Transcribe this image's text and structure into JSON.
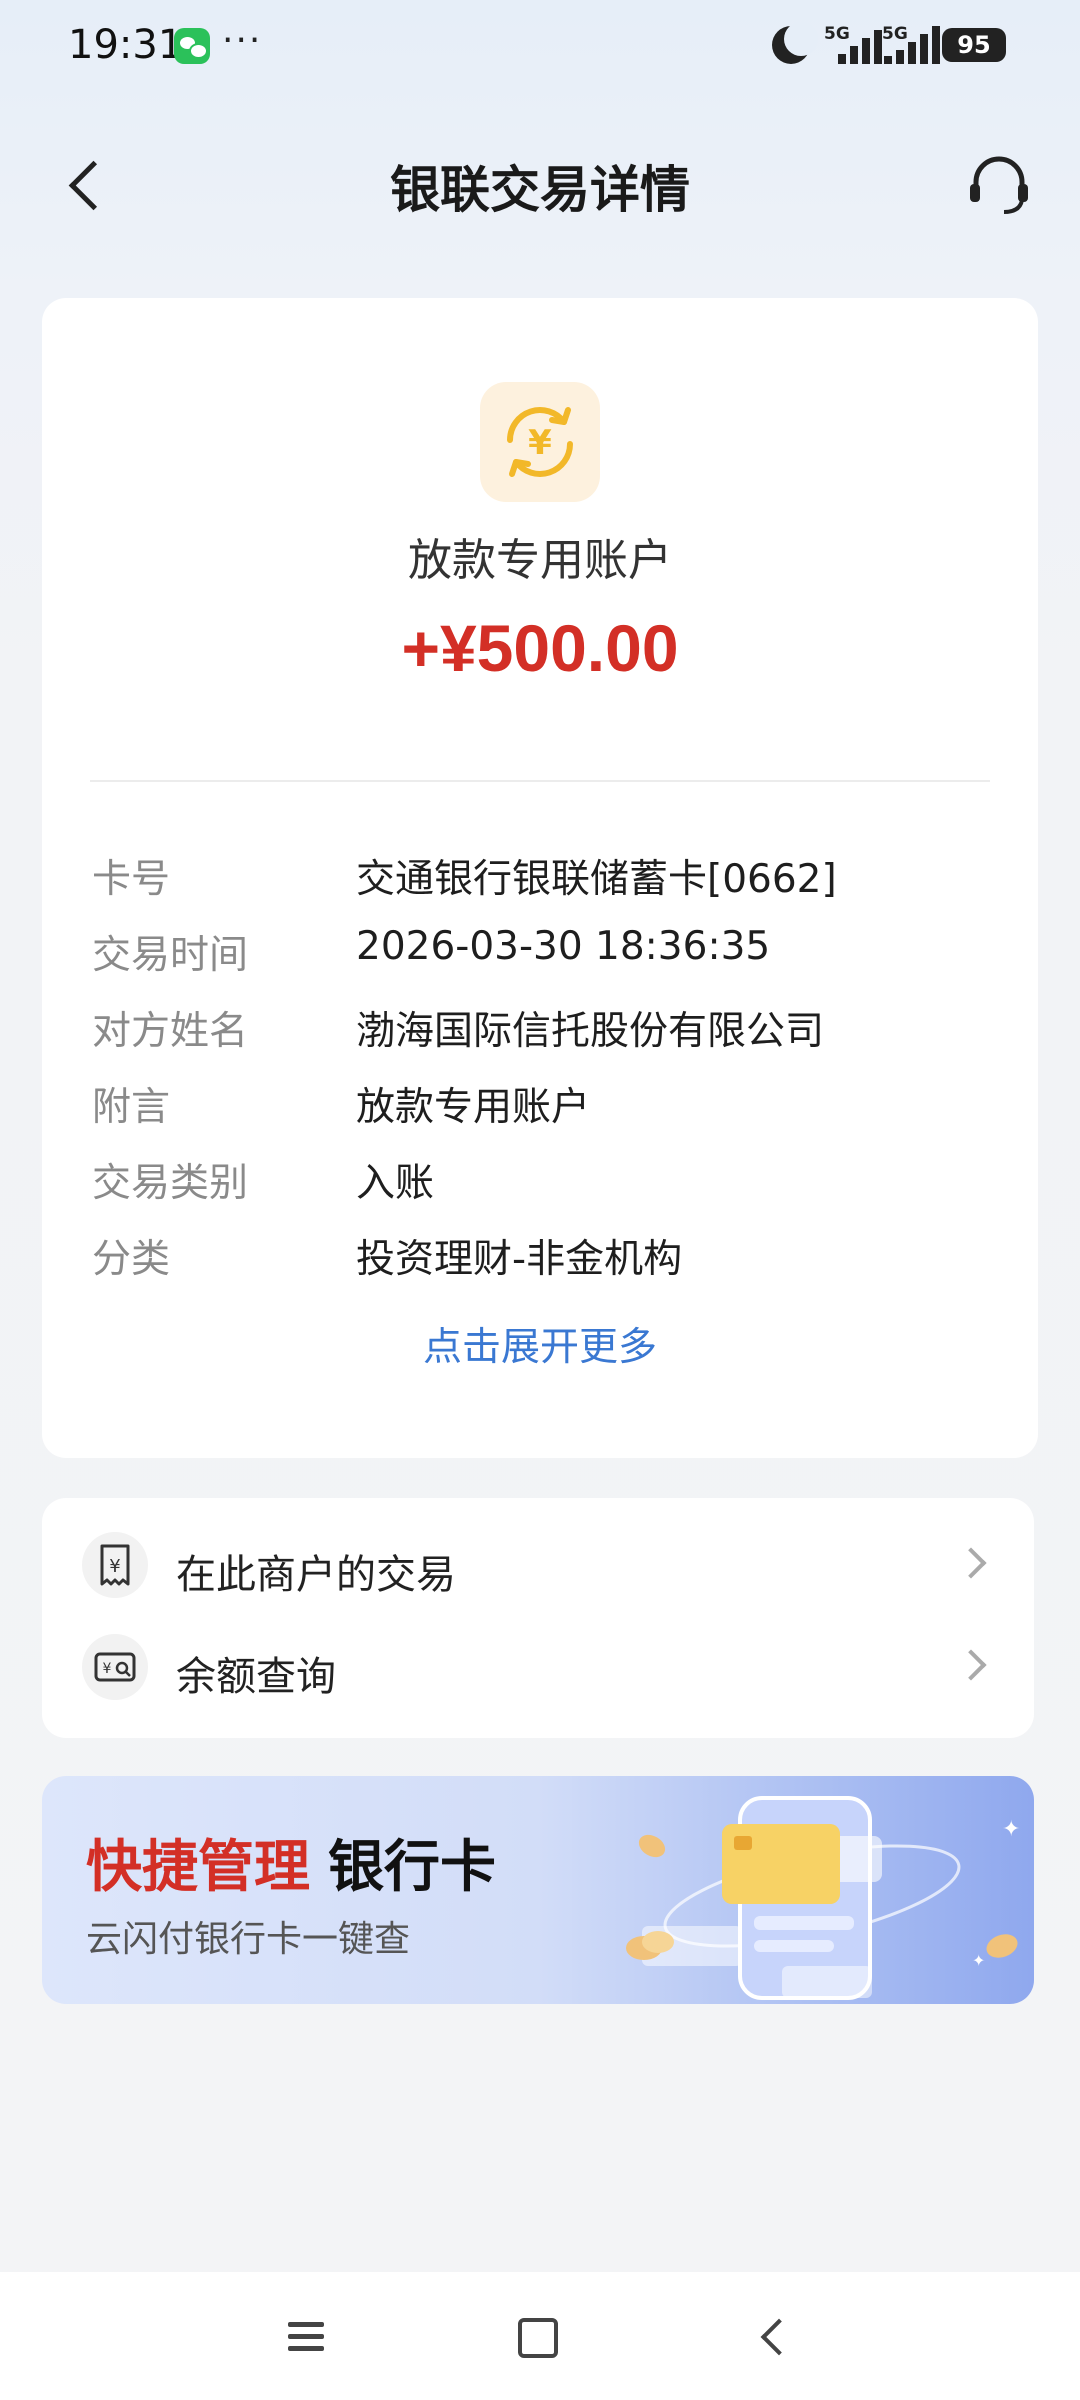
{
  "status_bar": {
    "time": "19:31",
    "more": "···",
    "network1": "5G",
    "network2": "5G",
    "battery": "95"
  },
  "header": {
    "title": "银联交易详情",
    "back_icon": "back-arrow-icon",
    "service_icon": "headset-icon"
  },
  "transaction": {
    "icon": "yuan-exchange-icon",
    "name": "放款专用账户",
    "amount": "+¥500.00",
    "details": [
      {
        "label": "卡号",
        "value": "交通银行银联储蓄卡[0662]"
      },
      {
        "label": "交易时间",
        "value": "2026-03-30 18:36:35"
      },
      {
        "label": "对方姓名",
        "value": "渤海国际信托股份有限公司"
      },
      {
        "label": "附言",
        "value": "放款专用账户"
      },
      {
        "label": "交易类别",
        "value": "入账"
      },
      {
        "label": "分类",
        "value": "投资理财-非金机构"
      }
    ],
    "expand_label": "点击展开更多"
  },
  "links": [
    {
      "label": "在此商户的交易",
      "icon": "receipt-yuan-icon"
    },
    {
      "label": "余额查询",
      "icon": "balance-search-icon"
    }
  ],
  "banner": {
    "title_red": "快捷管理",
    "title_black": "银行卡",
    "subtitle": "云闪付银行卡一键查"
  },
  "colors": {
    "amount": "#d32f26",
    "link": "#3a78d2",
    "icon_bg": "#fdf1de"
  }
}
